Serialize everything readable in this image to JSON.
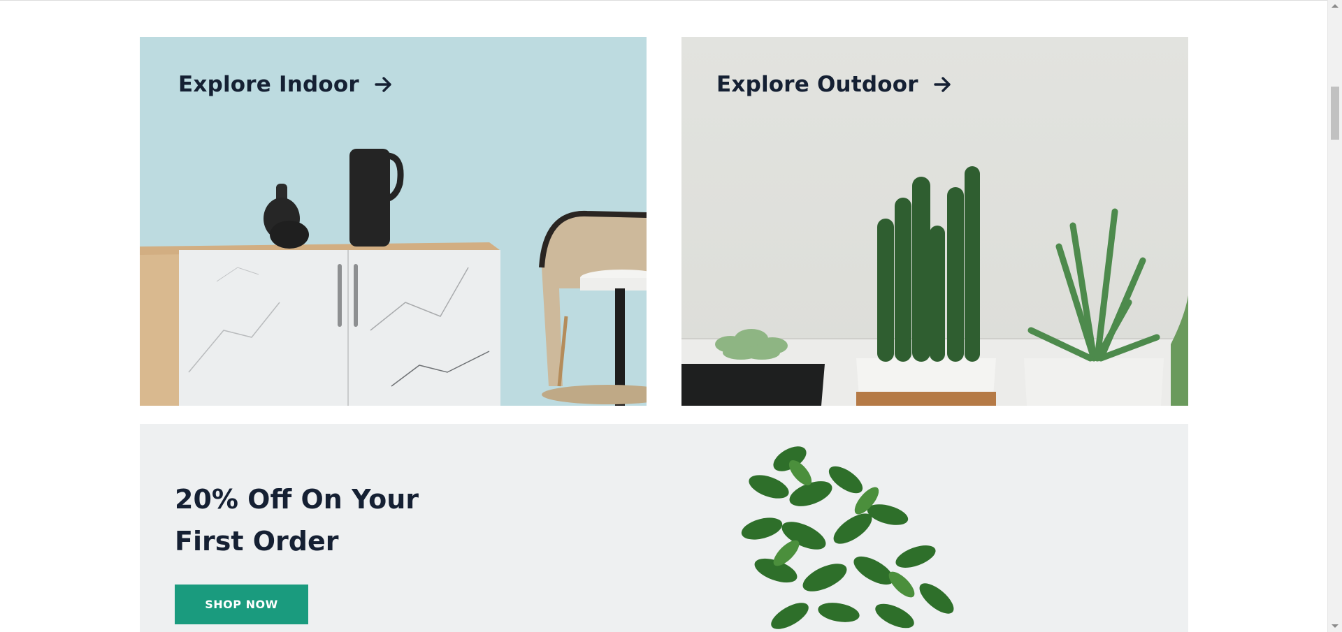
{
  "categories": {
    "indoor": {
      "label": "Explore Indoor",
      "icon": "arrow-right-icon",
      "background": "#bddbe0"
    },
    "outdoor": {
      "label": "Explore Outdoor",
      "icon": "arrow-right-icon",
      "background": "#dfe0dc"
    }
  },
  "promo": {
    "title_line1": "20% Off On Your",
    "title_line2": "First Order",
    "button_label": "SHOP NOW",
    "button_color": "#1a9b7e"
  },
  "colors": {
    "heading_text": "#152033",
    "promo_background": "#eef0f1"
  }
}
